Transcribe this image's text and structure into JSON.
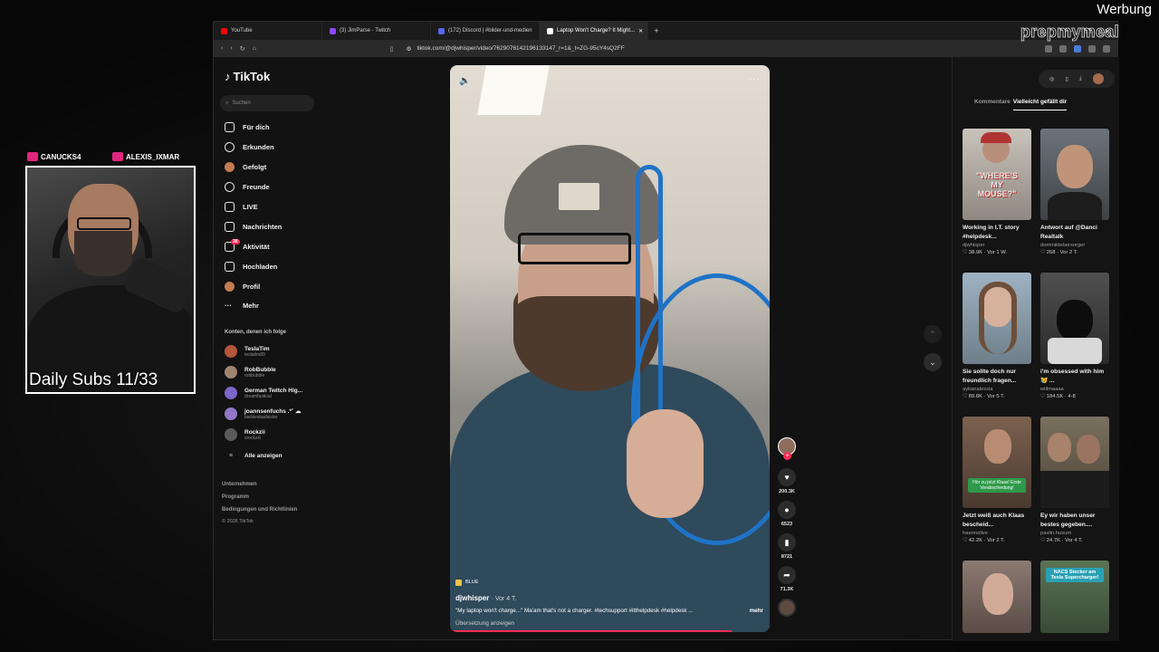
{
  "overlay": {
    "ad_label": "Werbung",
    "cam_user_left": "CANUCKS4",
    "cam_user_right": "ALEXIS_IXMAR",
    "cam_caption": "Daily Subs 11/33",
    "brand_watermark": "prepmymeal"
  },
  "browser": {
    "tabs": [
      {
        "label": "YouTube",
        "color": "#ff0000",
        "active": false
      },
      {
        "label": "(3) JimParse - Twitch",
        "color": "#9146ff",
        "active": false
      },
      {
        "label": "(172) Discord | #bilder-und-medien",
        "color": "#5865f2",
        "active": false
      },
      {
        "label": "Laptop Won't Charge? It Might...",
        "color": "#ffffff",
        "active": true
      }
    ],
    "url": "tiktok.com/@djwhisper/video/7629076142196133147_r=1&_t=ZG-95cY4sQ2FF"
  },
  "tiktok": {
    "logo": "TikTok",
    "search_placeholder": "Suchen",
    "nav": [
      {
        "label": "Für dich",
        "icon": "home-icon"
      },
      {
        "label": "Erkunden",
        "icon": "compass-icon"
      },
      {
        "label": "Gefolgt",
        "icon": "avatar-icon"
      },
      {
        "label": "Freunde",
        "icon": "friends-icon"
      },
      {
        "label": "LIVE",
        "icon": "live-icon"
      },
      {
        "label": "Nachrichten",
        "icon": "messages-icon"
      },
      {
        "label": "Aktivität",
        "icon": "activity-icon",
        "badge": "38"
      },
      {
        "label": "Hochladen",
        "icon": "upload-icon"
      },
      {
        "label": "Profil",
        "icon": "profile-icon"
      },
      {
        "label": "Mehr",
        "icon": "more-icon"
      }
    ],
    "following_label": "Konten, denen ich folge",
    "following": [
      {
        "name": "TeslaTim",
        "handle": "teslatim89",
        "color": "#b5563a"
      },
      {
        "name": "RobBubble",
        "handle": "robbubble",
        "color": "#a0846e"
      },
      {
        "name": "German Twitch Hig...",
        "handle": "dreamfastical",
        "color": "#7b67c9"
      },
      {
        "name": "joannsenfuchs .*˚ ☁",
        "handle": "barbiesbadsister",
        "color": "#9378c8"
      },
      {
        "name": "Rockzii",
        "handle": "xrockziii",
        "color": "#5a5a5a"
      }
    ],
    "show_all": "Alle anzeigen",
    "footer": [
      "Unternehmen",
      "Programm",
      "Bedingungen und Richtlinien"
    ],
    "copyright": "© 2026 TikTok"
  },
  "video": {
    "tag": "BLUE",
    "author": "djwhisper",
    "age": "· Vor 4 T.",
    "description": "\"My laptop won't charge...\" Ma'am that's not a charger. #techsupport #itthelpdesk #helpdesk ...",
    "more_label": "mehr",
    "translate": "Übersetzung anzeigen",
    "progress": 0.88,
    "likes": "200.3K",
    "comments": "6523",
    "saves": "8721",
    "shares": "71.3K"
  },
  "panel": {
    "tabs": [
      "Kommentare",
      "Vielleicht gefällt dir"
    ],
    "videos": [
      {
        "title": "Working in I.T. story #helpdesk...",
        "user": "djwhisper",
        "meta": "♡ 38.9K · Vor 1 W.",
        "thumb_text": "\"WHERE'S MY MOUSE?\"",
        "bg": "#b8b3aa"
      },
      {
        "title": "Antwort auf @Danci Realtalk",
        "user": "dominiklebersorger",
        "meta": "♡ 268 · Vor 2 T.",
        "bg": "#5f6a73"
      },
      {
        "title": "Sie sollte doch nur freundlich fragen...",
        "user": "aykanalessia",
        "meta": "♡ 89.8K · Vor 5 T.",
        "bg": "#8fa2b3"
      },
      {
        "title": "i'm obsessed with him 😿 ...",
        "user": "willmaaaa",
        "meta": "♡ 184.5K · 4-8",
        "bg": "#3b3b3b"
      },
      {
        "title": "Jetzt weiß auch Klaas bescheid...",
        "user": "haennolive",
        "meta": "♡ 42.2K · Vor 2 T.",
        "sticker": "Hör zu jetzt Klaas! Erste Verabschiedung!",
        "bg": "#6a5444"
      },
      {
        "title": "Ey wir haben unser bestes gegeben....",
        "user": "pavlin.husum",
        "meta": "♡ 24.7K · Vor 4 T.",
        "bg": "#6b6252"
      },
      {
        "title": "",
        "user": "",
        "meta": "",
        "bg": "#7f6e68"
      },
      {
        "title": "",
        "user": "",
        "meta": "",
        "sticker2": "NACS Stecker am Tesla Supercharger!",
        "bg": "#4f6b4a"
      }
    ]
  }
}
